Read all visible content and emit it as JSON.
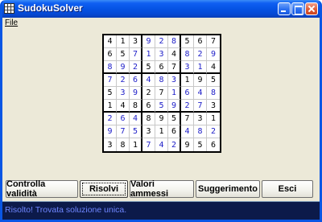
{
  "window": {
    "title": "SudokuSolver",
    "controls": [
      "minimize-icon",
      "maximize-icon",
      "close-icon"
    ]
  },
  "menu": {
    "file_label": "File"
  },
  "sudoku": {
    "rows": [
      [
        4,
        1,
        3,
        9,
        2,
        8,
        5,
        6,
        7
      ],
      [
        6,
        5,
        7,
        1,
        3,
        4,
        8,
        2,
        9
      ],
      [
        8,
        9,
        2,
        5,
        6,
        7,
        3,
        1,
        4
      ],
      [
        7,
        2,
        6,
        4,
        8,
        3,
        1,
        9,
        5
      ],
      [
        5,
        3,
        9,
        2,
        7,
        1,
        6,
        4,
        8
      ],
      [
        1,
        4,
        8,
        6,
        5,
        9,
        2,
        7,
        3
      ],
      [
        2,
        6,
        4,
        8,
        9,
        5,
        7,
        3,
        1
      ],
      [
        9,
        7,
        5,
        3,
        1,
        6,
        4,
        8,
        2
      ],
      [
        3,
        8,
        1,
        7,
        4,
        2,
        9,
        5,
        6
      ]
    ],
    "given_mask": [
      [
        1,
        1,
        1,
        0,
        0,
        0,
        1,
        1,
        1
      ],
      [
        1,
        1,
        0,
        0,
        0,
        1,
        0,
        0,
        0
      ],
      [
        0,
        0,
        0,
        1,
        1,
        1,
        0,
        0,
        1
      ],
      [
        0,
        0,
        0,
        0,
        0,
        0,
        1,
        1,
        1
      ],
      [
        1,
        0,
        0,
        1,
        1,
        0,
        0,
        0,
        0
      ],
      [
        1,
        1,
        1,
        1,
        0,
        0,
        0,
        0,
        1
      ],
      [
        0,
        0,
        0,
        1,
        1,
        1,
        1,
        1,
        1
      ],
      [
        0,
        0,
        0,
        1,
        1,
        1,
        0,
        0,
        0
      ],
      [
        1,
        1,
        1,
        0,
        0,
        0,
        1,
        1,
        1
      ]
    ],
    "colors": {
      "given": "#000000",
      "solved": "#1c1cc8"
    }
  },
  "buttons": [
    {
      "name": "check-validity-button",
      "label": "Controlla validità"
    },
    {
      "name": "solve-button",
      "label": "Risolvi"
    },
    {
      "name": "allowed-values-button",
      "label": "Valori ammessi"
    },
    {
      "name": "hint-button",
      "label": "Suggerimento"
    },
    {
      "name": "exit-button",
      "label": "Esci"
    }
  ],
  "status": {
    "text": "Risolto! Trovata soluzione unica."
  }
}
